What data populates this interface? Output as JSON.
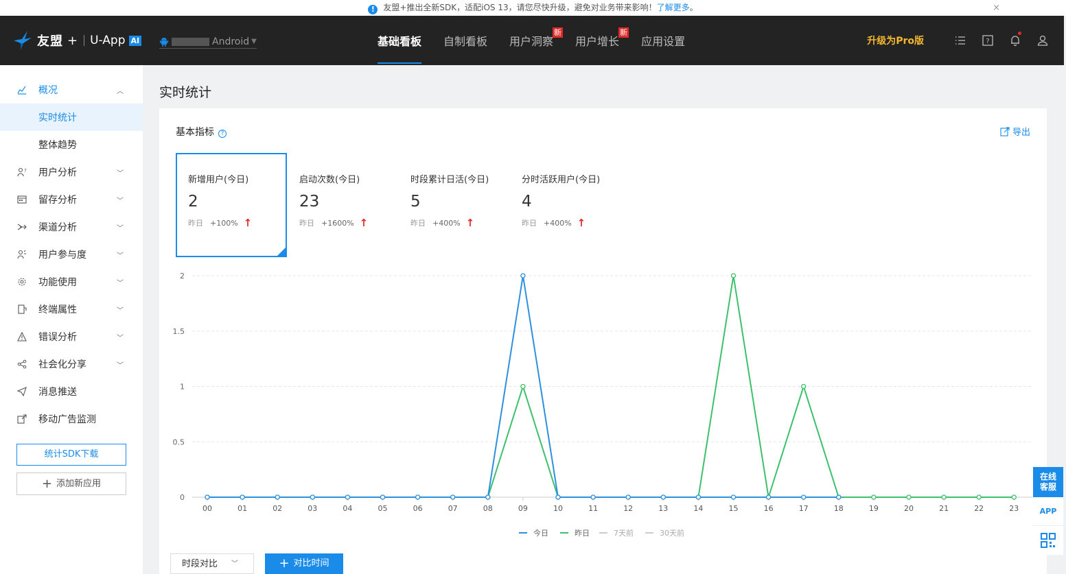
{
  "notice": {
    "text": "友盟+推出全新SDK，适配iOS 13，请您尽快升级，避免对业务带来影响！",
    "link": "了解更多",
    "tail": "。",
    "close": "×"
  },
  "header": {
    "brand": "友盟",
    "brand_plus": "+",
    "product": "U-App",
    "ai_badge": "AI",
    "platform": "Android",
    "nav": [
      {
        "label": "基础看板",
        "active": true
      },
      {
        "label": "自制看板"
      },
      {
        "label": "用户洞察",
        "badge": "新"
      },
      {
        "label": "用户增长",
        "badge": "新"
      },
      {
        "label": "应用设置"
      }
    ],
    "upgrade": "升级为Pro版"
  },
  "sidebar": {
    "items": [
      {
        "label": "概况",
        "icon": "overview-icon"
      },
      {
        "label": "实时统计"
      },
      {
        "label": "整体趋势"
      },
      {
        "label": "用户分析",
        "icon": "user-analysis-icon"
      },
      {
        "label": "留存分析",
        "icon": "retention-icon"
      },
      {
        "label": "渠道分析",
        "icon": "channel-icon"
      },
      {
        "label": "用户参与度",
        "icon": "engagement-icon"
      },
      {
        "label": "功能使用",
        "icon": "feature-icon"
      },
      {
        "label": "终端属性",
        "icon": "device-icon"
      },
      {
        "label": "错误分析",
        "icon": "error-icon"
      },
      {
        "label": "社会化分享",
        "icon": "share-icon"
      },
      {
        "label": "消息推送",
        "icon": "push-icon"
      },
      {
        "label": "移动广告监测",
        "icon": "ad-monitor-icon"
      }
    ],
    "sdk_button": "统计SDK下载",
    "add_app_button": "添加新应用"
  },
  "main": {
    "page_title": "实时统计",
    "panel_title": "基本指标",
    "export": "导出",
    "metrics": [
      {
        "label": "新增用户(今日)",
        "value": "2",
        "yesterday": "昨日",
        "change": "+100%"
      },
      {
        "label": "启动次数(今日)",
        "value": "23",
        "yesterday": "昨日",
        "change": "+1600%"
      },
      {
        "label": "时段累计日活(今日)",
        "value": "5",
        "yesterday": "昨日",
        "change": "+400%"
      },
      {
        "label": "分时活跃用户(今日)",
        "value": "4",
        "yesterday": "昨日",
        "change": "+400%"
      }
    ],
    "period_select": "时段对比",
    "compare_button": "对比时间"
  },
  "float": {
    "service_line1": "在线",
    "service_line2": "客服",
    "app": "APP"
  },
  "chart_data": {
    "type": "line",
    "x": [
      "00",
      "01",
      "02",
      "03",
      "04",
      "05",
      "06",
      "07",
      "08",
      "09",
      "10",
      "11",
      "12",
      "13",
      "14",
      "15",
      "16",
      "17",
      "18",
      "19",
      "20",
      "21",
      "22",
      "23"
    ],
    "yticks": [
      "0",
      "0.5",
      "1",
      "1.5",
      "2"
    ],
    "ylim": [
      0,
      2
    ],
    "grid": true,
    "legend_position": "bottom",
    "series": [
      {
        "name": "今日",
        "color": "#2c8fe0",
        "values": [
          0,
          0,
          0,
          0,
          0,
          0,
          0,
          0,
          0,
          2,
          0,
          0,
          0,
          0,
          0,
          0,
          0,
          0,
          0,
          null,
          null,
          null,
          null,
          null
        ]
      },
      {
        "name": "昨日",
        "color": "#3cc06a",
        "values": [
          0,
          0,
          0,
          0,
          0,
          0,
          0,
          0,
          0,
          1,
          0,
          0,
          0,
          0,
          0,
          2,
          0,
          1,
          0,
          0,
          0,
          0,
          0,
          0
        ]
      },
      {
        "name": "7天前",
        "color": "#cccccc",
        "values": []
      },
      {
        "name": "30天前",
        "color": "#cccccc",
        "values": []
      }
    ]
  }
}
